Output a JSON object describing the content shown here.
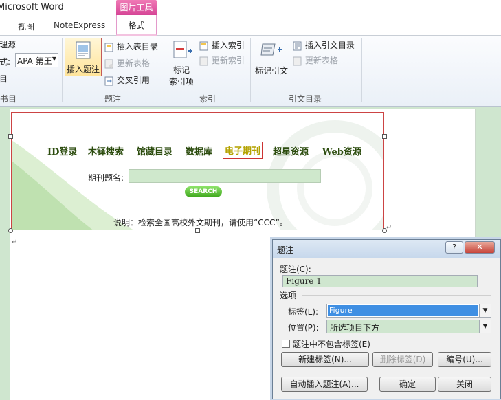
{
  "window": {
    "app_title": "Microsoft Word"
  },
  "tabs": {
    "context_header": "图片工具",
    "view": "视图",
    "noteexpress": "NoteExpress",
    "format": "格式"
  },
  "ribbon": {
    "left_cut": {
      "manage_sources": "理源",
      "style_label": "式:",
      "style_value": "APA 第王",
      "bibliography": "目",
      "group_label": "书目"
    },
    "caption_group": {
      "insert_caption": "插入题注",
      "insert_table_of_figures": "插入表目录",
      "update_table": "更新表格",
      "cross_reference": "交叉引用",
      "group_label": "题注"
    },
    "index_group": {
      "mark_entry_line1": "标记",
      "mark_entry_line2": "索引项",
      "insert_index": "插入索引",
      "update_index": "更新索引",
      "group_label": "索引"
    },
    "toa_group": {
      "mark_citation": "标记引文",
      "insert_toa": "插入引文目录",
      "update_table": "更新表格",
      "group_label": "引文目录"
    }
  },
  "document": {
    "nav_items": [
      "ID登录",
      "木铎搜索",
      "馆藏目录",
      "数据库",
      "电子期刊",
      "超星资源",
      "Web资源"
    ],
    "journal_label": "期刊题名:",
    "search_button": "SEARCH",
    "note": "说明：检索全国高校外文期刊，请使用“CCC”。"
  },
  "dialog": {
    "title": "题注",
    "help": "?",
    "caption_label": "题注(C):",
    "caption_value": "Figure 1",
    "options_label": "选项",
    "label_label": "标签(L):",
    "label_value": "Figure",
    "position_label": "位置(P):",
    "position_value": "所选项目下方",
    "exclude_label_checkbox": "题注中不包含标签(E)",
    "new_label_button": "新建标签(N)...",
    "delete_label_button": "删除标签(D)",
    "numbering_button": "编号(U)...",
    "autocaption_button": "自动插入题注(A)...",
    "ok_button": "确定",
    "close_button": "关闭"
  }
}
